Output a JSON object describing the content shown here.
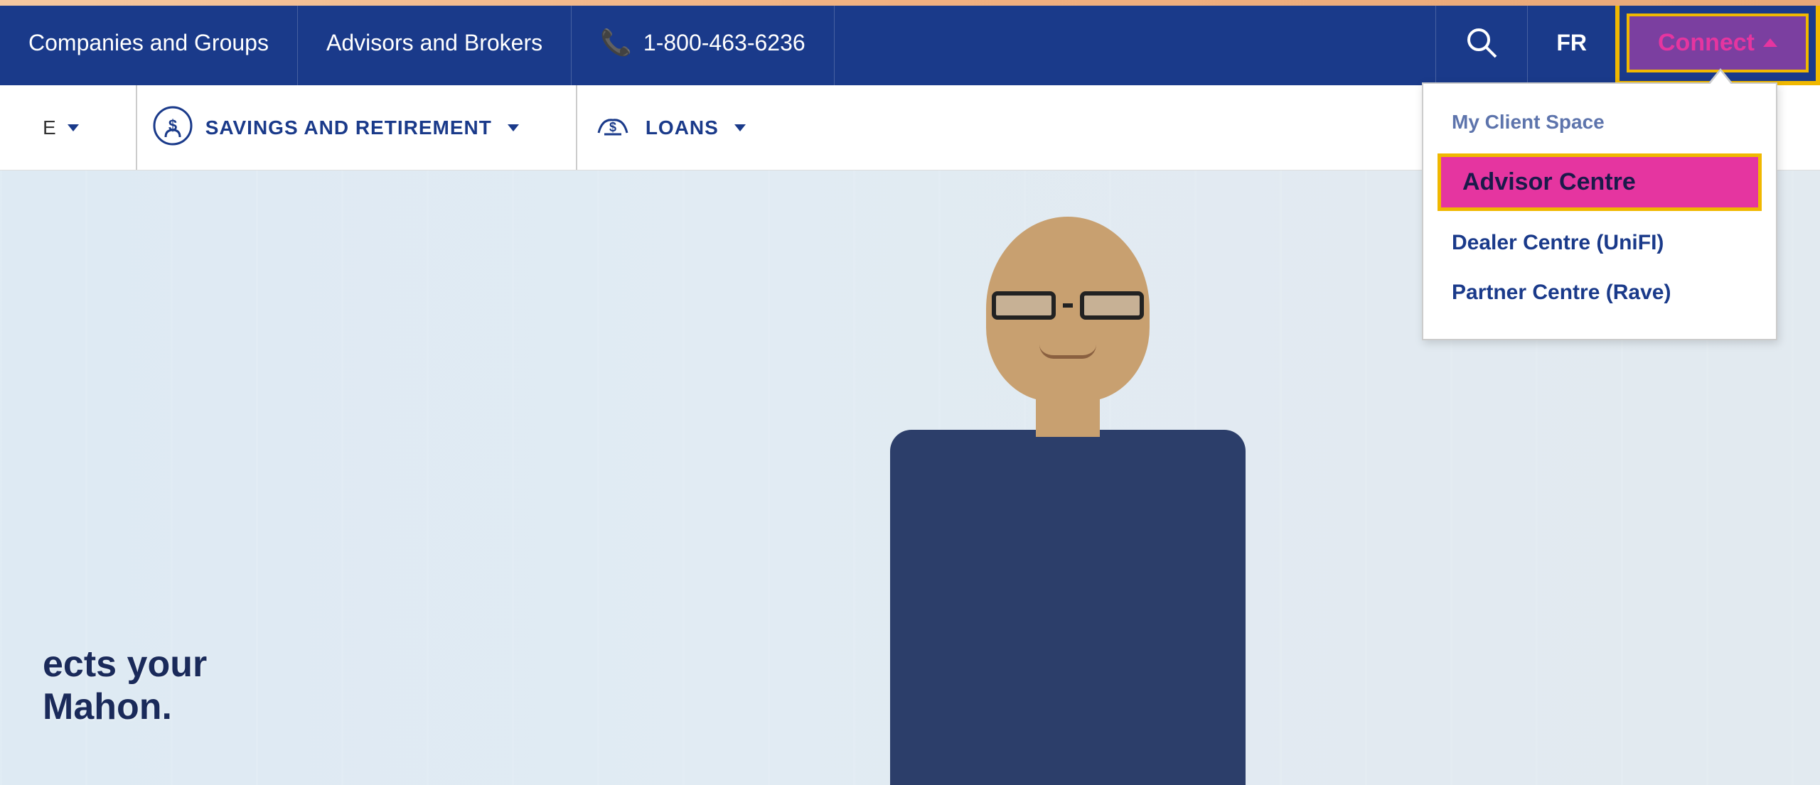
{
  "colors": {
    "nav_blue": "#1a3a8a",
    "connect_purple": "#7b3fa0",
    "connect_text_pink": "#e535a0",
    "highlight_yellow": "#f0b800",
    "advisor_centre_bg": "#e535a0",
    "white": "#ffffff",
    "peach": "#f4c8a0"
  },
  "topbar": {
    "companies_label": "Companies and Groups",
    "advisors_label": "Advisors and Brokers",
    "phone_number": "1-800-463-6236",
    "fr_label": "FR",
    "connect_label": "Connect"
  },
  "navbar": {
    "first_item_label": "E",
    "savings_label": "SAVINGS AND RETIREMENT",
    "loans_label": "LOANS"
  },
  "dropdown": {
    "my_client_space": "My Client Space",
    "advisor_centre": "Advisor Centre",
    "dealer_centre": "Dealer Centre (UniFI)",
    "partner_centre": "Partner Centre (Rave)"
  },
  "hero": {
    "text_line1": "ects your",
    "text_line2": "Mahon."
  }
}
